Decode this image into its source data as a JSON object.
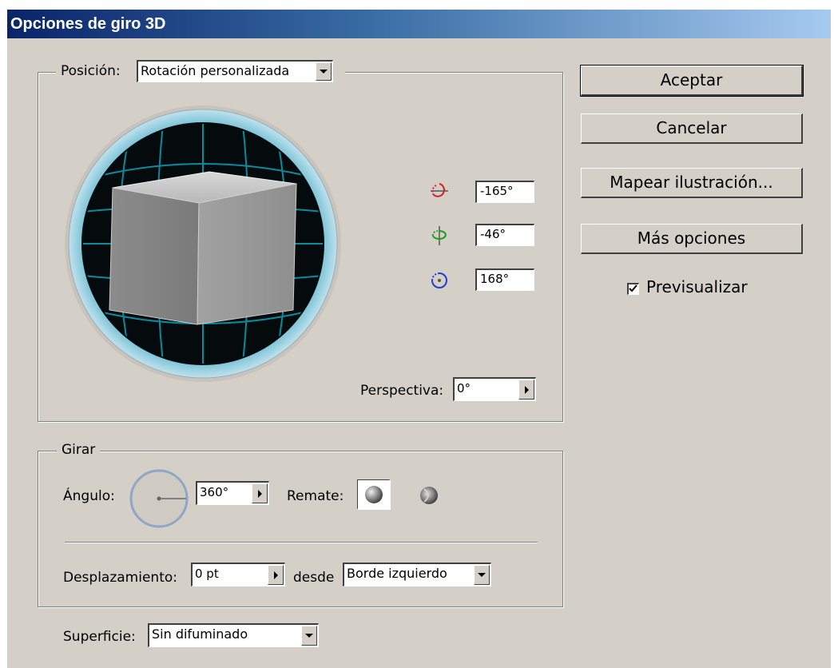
{
  "window": {
    "title": "Opciones de giro 3D"
  },
  "position": {
    "label": "Posición:",
    "selected": "Rotación personalizada",
    "rotation_x": "-165°",
    "rotation_y": "-46°",
    "rotation_z": "168°",
    "perspective_label": "Perspectiva:",
    "perspective_value": "0°"
  },
  "revolve": {
    "legend": "Girar",
    "angle_label": "Ángulo:",
    "angle_value": "360°",
    "cap_label": "Remate:",
    "offset_label": "Desplazamiento:",
    "offset_value": "0 pt",
    "from_label": "desde",
    "from_selected": "Borde izquierdo"
  },
  "surface": {
    "label": "Superficie:",
    "selected": "Sin difuminado"
  },
  "buttons": {
    "ok": "Aceptar",
    "cancel": "Cancelar",
    "map_art": "Mapear ilustración...",
    "more_options": "Más opciones"
  },
  "preview": {
    "label": "Previsualizar",
    "checked": true
  },
  "colors": {
    "dialog_bg": "#d4d0c8",
    "title_gradient_start": "#0a246a",
    "title_gradient_end": "#a6caf0",
    "rotate_x_icon": "#d42020",
    "rotate_y_icon": "#1e9e1e",
    "rotate_z_icon": "#1f3fd0",
    "track_grid": "#0aa4b8"
  }
}
